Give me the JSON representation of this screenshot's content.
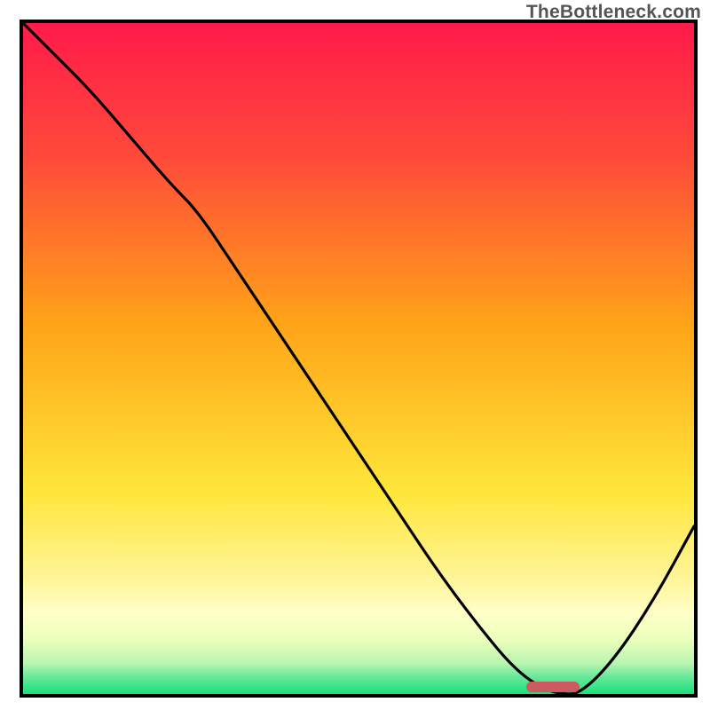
{
  "watermark": "TheBottleneck.com",
  "colors": {
    "red_top": "#ff1a4a",
    "orange_mid": "#ffa418",
    "yellow_low": "#ffe63a",
    "pale_yellow": "#ffffb0",
    "green_bottom": "#1ae07a",
    "curve": "#000000",
    "border": "#000000",
    "marker": "#cc5a60",
    "watermark_text": "#555555"
  },
  "gradient_stops": [
    {
      "offset": 0.0,
      "color": "#ff1a4a"
    },
    {
      "offset": 0.2,
      "color": "#ff4a3a"
    },
    {
      "offset": 0.45,
      "color": "#ffa418"
    },
    {
      "offset": 0.7,
      "color": "#ffe63a"
    },
    {
      "offset": 0.83,
      "color": "#fff59a"
    },
    {
      "offset": 0.88,
      "color": "#ffffc8"
    },
    {
      "offset": 0.92,
      "color": "#eaffba"
    },
    {
      "offset": 0.955,
      "color": "#b7f5b0"
    },
    {
      "offset": 0.975,
      "color": "#66e898"
    },
    {
      "offset": 1.0,
      "color": "#1ae07a"
    }
  ],
  "chart_data": {
    "type": "line",
    "title": "",
    "xlabel": "",
    "ylabel": "",
    "xlim": [
      0,
      100
    ],
    "ylim": [
      0,
      100
    ],
    "x": [
      0,
      4,
      10,
      16,
      22,
      26,
      32,
      38,
      44,
      50,
      56,
      62,
      68,
      73,
      77,
      80,
      83,
      88,
      94,
      100
    ],
    "values": [
      100,
      96,
      90,
      83,
      76,
      72,
      63,
      54,
      45,
      36,
      27,
      18,
      10,
      4,
      1,
      0,
      0,
      5,
      14,
      25
    ],
    "marker": {
      "x_start": 75,
      "x_end": 83,
      "y": 0
    },
    "annotations": [
      "TheBottleneck.com"
    ]
  }
}
